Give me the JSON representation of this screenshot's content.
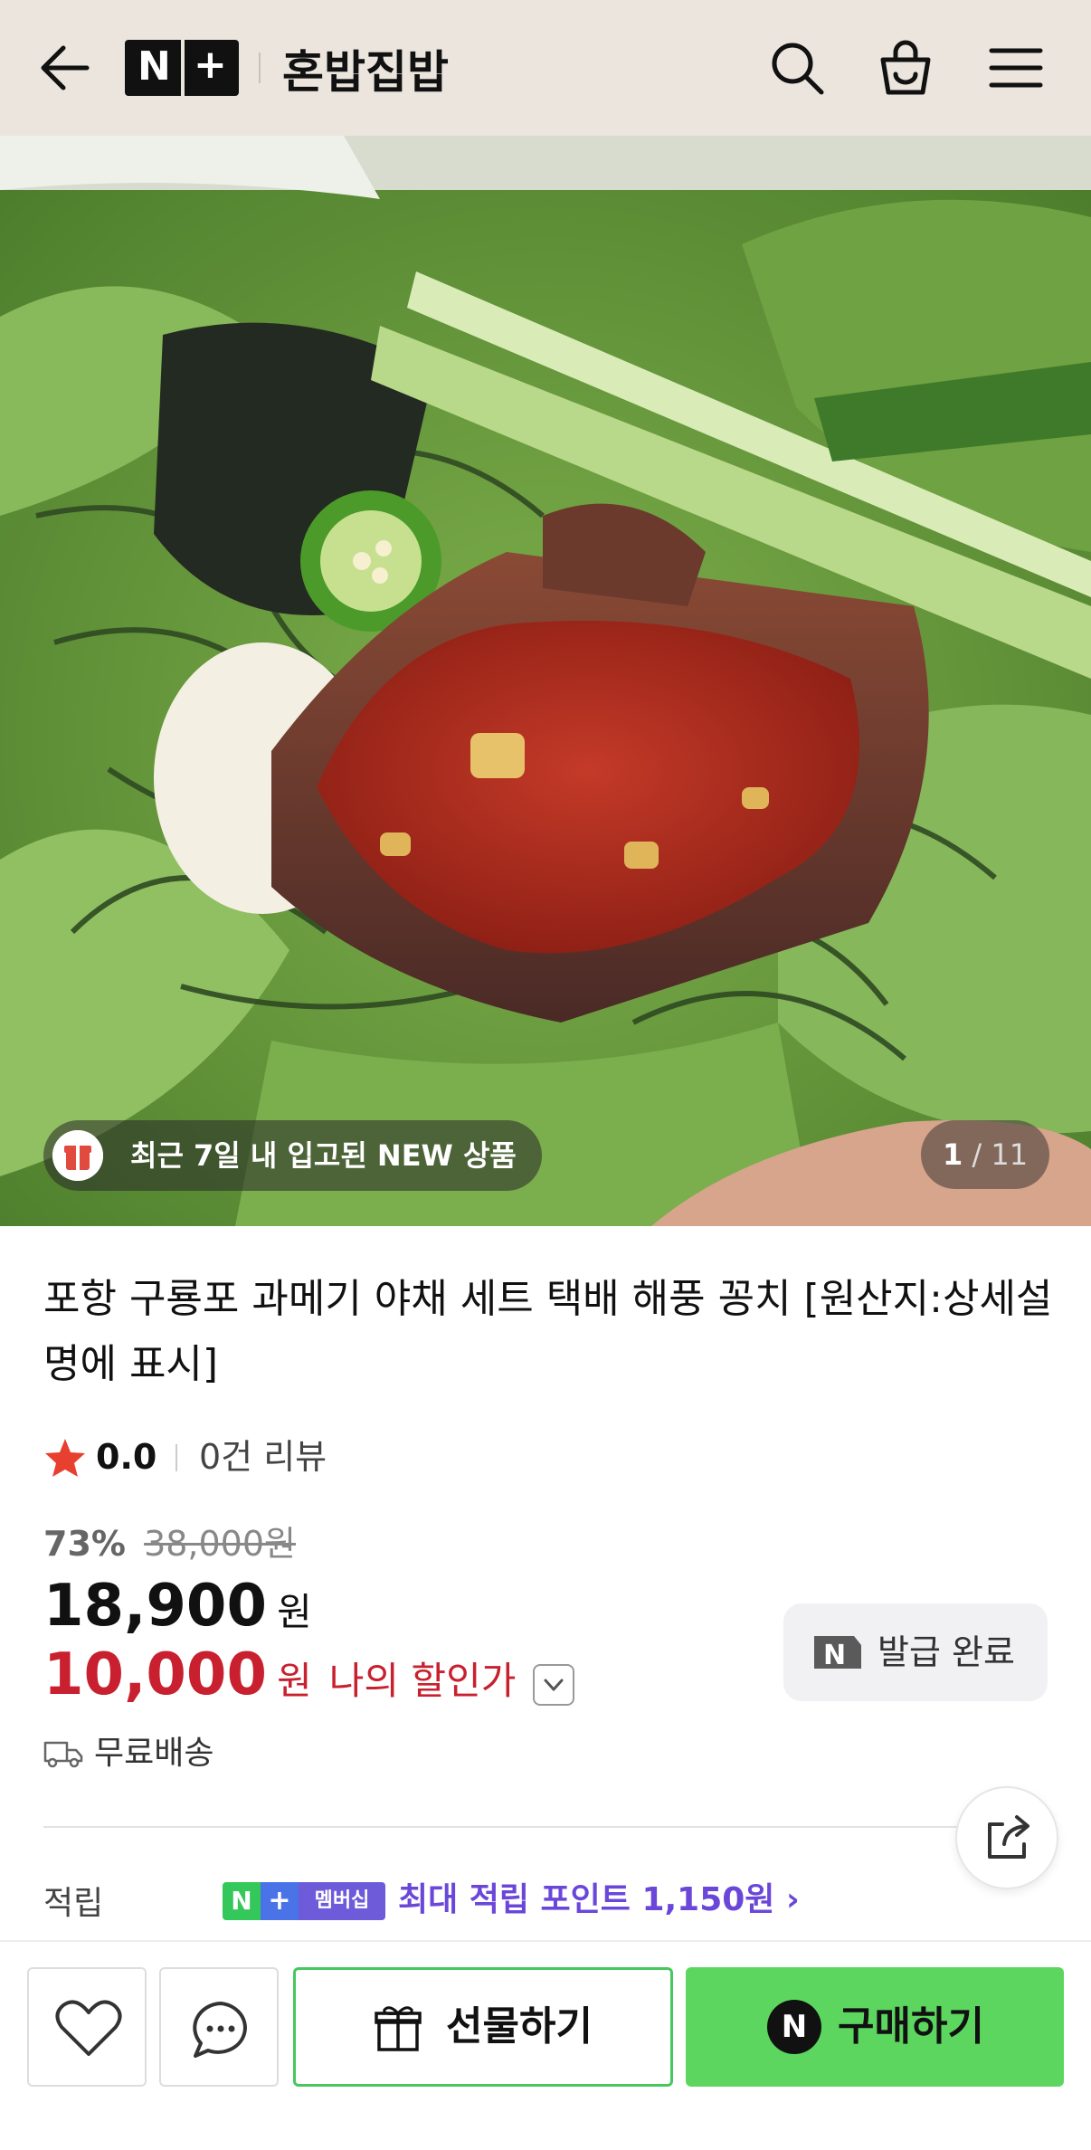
{
  "header": {
    "logo_text": "N+",
    "store_name": "혼밥집밥"
  },
  "hero": {
    "badge_text": "최근 7일 내 입고된 NEW 상품",
    "counter_current": "1",
    "counter_total": "/ 11"
  },
  "product": {
    "title": "포항 구룡포 과메기 야채 세트 택배 해풍 꽁치 [원산지:상세설명에 표시]",
    "rating": "0.0",
    "review_count": "0건 리뷰",
    "discount_rate": "73%",
    "original_price": "38,000원",
    "price": "18,900",
    "price_unit": "원",
    "my_price": "10,000",
    "my_price_unit": "원",
    "my_price_label": "나의 할인가",
    "coupon_label": "발급 완료",
    "shipping": "무료배송"
  },
  "points": {
    "label": "적립",
    "badge_n": "N",
    "badge_plus": "+",
    "badge_membership": "멤버십",
    "text": "최대 적립 포인트 1,150원 ›"
  },
  "bottom_bar": {
    "gift_label": "선물하기",
    "buy_label": "구매하기",
    "buy_icon": "N"
  },
  "colors": {
    "header_bg": "#ebe5de",
    "discount_red": "#c8202f",
    "buy_green": "#5cd65f",
    "points_purple": "#6b47d9"
  }
}
